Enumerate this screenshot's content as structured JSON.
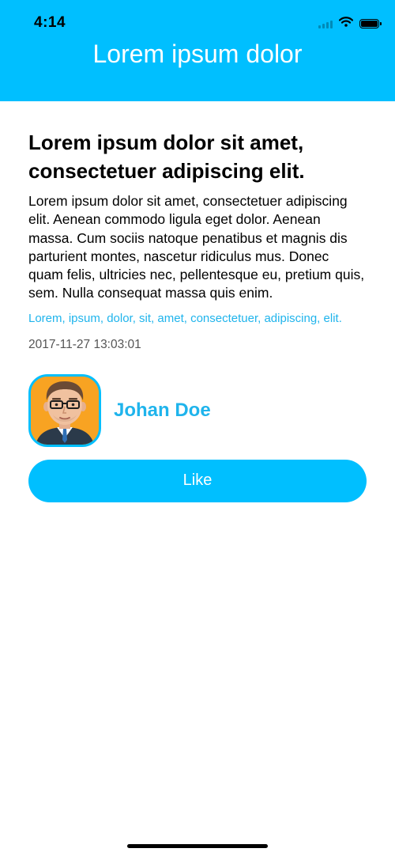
{
  "status_bar": {
    "time": "4:14",
    "icons": [
      "signal-icon",
      "wifi-icon",
      "battery-icon"
    ]
  },
  "nav": {
    "title": "Lorem ipsum dolor"
  },
  "article": {
    "title": "Lorem ipsum dolor sit amet, consectetuer adipiscing elit.",
    "body": "Lorem ipsum dolor sit amet, consectetuer adipiscing elit. Aenean commodo ligula eget dolor. Aenean massa. Cum sociis natoque penatibus et magnis dis parturient montes, nascetur ridiculus mus. Donec quam felis, ultricies nec, pellentesque eu, pretium quis, sem. Nulla consequat massa quis enim.",
    "tags": "Lorem, ipsum, dolor, sit, amet, consectetuer, adipiscing, elit.",
    "timestamp": "2017-11-27 13:03:01"
  },
  "author": {
    "name": "Johan Doe",
    "avatar_icon": "man-with-glasses-avatar"
  },
  "actions": {
    "like_label": "Like"
  },
  "colors": {
    "accent": "#00BFFF",
    "link": "#1FB4EC",
    "muted": "#555555"
  }
}
